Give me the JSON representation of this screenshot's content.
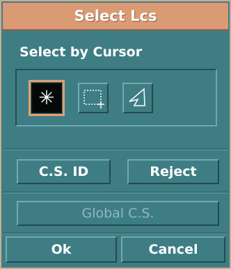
{
  "dialog": {
    "title": "Select Lcs",
    "section_label": "Select by Cursor",
    "tools": [
      {
        "icon": "crosshair-star-icon",
        "selected": true,
        "glyph": "✳"
      },
      {
        "icon": "rectangle-select-icon",
        "selected": false
      },
      {
        "icon": "polygon-select-icon",
        "selected": false
      }
    ],
    "buttons": {
      "cs_id": "C.S. ID",
      "reject": "Reject",
      "global_cs": "Global C.S.",
      "ok": "Ok",
      "cancel": "Cancel"
    }
  },
  "colors": {
    "panel": "#3e7d84",
    "title_bar": "#d99a74",
    "frame": "#c9ad92",
    "selected_outline": "#e0a070"
  }
}
